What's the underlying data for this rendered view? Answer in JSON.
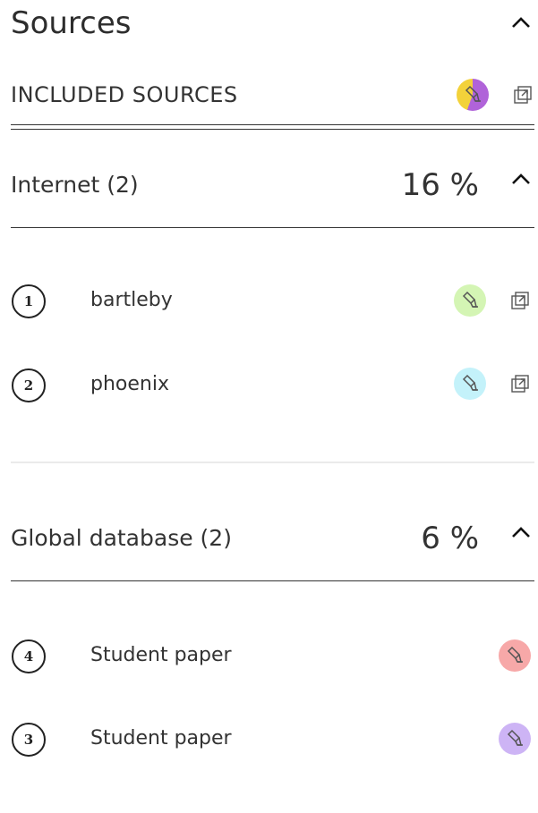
{
  "panel": {
    "title": "Sources",
    "included_label": "INCLUDED SOURCES"
  },
  "groups": [
    {
      "name": "Internet (2)",
      "percent": "16 %",
      "sources": [
        {
          "number": "1",
          "name": "bartleby",
          "color": "#d4f5b4"
        },
        {
          "number": "2",
          "name": "phoenix",
          "color": "#c4f2fa"
        }
      ]
    },
    {
      "name": "Global database (2)",
      "percent": "6 %",
      "sources": [
        {
          "number": "4",
          "name": "Student paper",
          "color": "#f7a8a8"
        },
        {
          "number": "3",
          "name": "Student paper",
          "color": "#cdb4f5"
        }
      ]
    }
  ],
  "colors": {
    "included_highlight_a": "#b063d9",
    "included_highlight_b": "#f3d23a"
  },
  "icons": {
    "collapse": "chevron-up-icon",
    "highlight": "highlighter-icon",
    "open_external": "open-in-new-icon"
  }
}
